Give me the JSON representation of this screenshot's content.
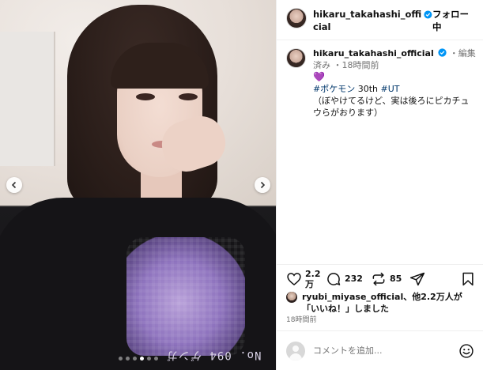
{
  "account": {
    "username": "hikaru_takahashi_official",
    "follow_status": "フォロー中"
  },
  "post": {
    "username": "hikaru_takahashi_official",
    "edited_label": "・編集済み",
    "time_ago": "・18時間前",
    "emoji": "💜",
    "tag1": "#ポケモン",
    "text1": " 30th ",
    "tag2": "#UT",
    "caption": "（ぼやけてるけど、実は後ろにピカチュウらがおります）"
  },
  "photo": {
    "print_text": "No. 094 ゲンガ"
  },
  "carousel": {
    "slides": 6,
    "active": 3
  },
  "actions": {
    "like_count": "2.2万",
    "comment_count": "232",
    "repost_count": "85"
  },
  "likes": {
    "liker": "ryubi_miyase_official",
    "text": "、他2.2万人が「いいね！」しました"
  },
  "timestamp": "18時間前",
  "comment": {
    "placeholder": "コメントを追加..."
  },
  "colors": {
    "verified_blue": "#0095f6",
    "hashtag": "#00376b",
    "meta_gray": "#737373"
  }
}
